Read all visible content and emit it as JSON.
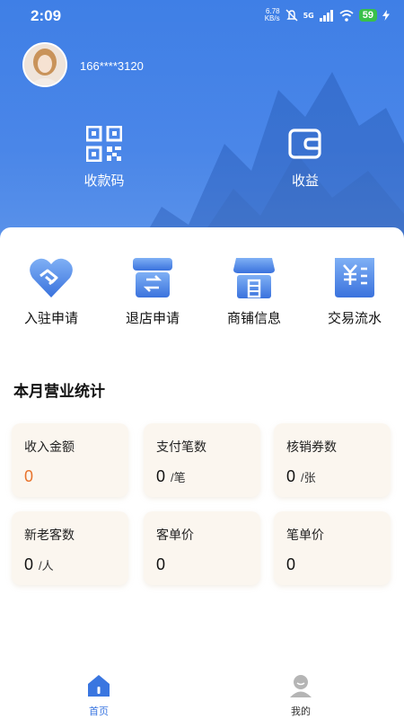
{
  "status_bar": {
    "time": "2:09",
    "net_speed_value": "6.78",
    "net_speed_unit": "KB/s",
    "network": "5G",
    "battery": "59"
  },
  "profile": {
    "phone": "166****3120"
  },
  "hero_actions": [
    {
      "label": "收款码",
      "icon": "qr-code-icon"
    },
    {
      "label": "收益",
      "icon": "wallet-icon"
    }
  ],
  "menu": [
    {
      "label": "入驻申请",
      "icon": "handshake-heart-icon"
    },
    {
      "label": "退店申请",
      "icon": "store-return-icon"
    },
    {
      "label": "商铺信息",
      "icon": "shop-icon"
    },
    {
      "label": "交易流水",
      "icon": "yen-ledger-icon"
    }
  ],
  "stats": {
    "title": "本月营业统计",
    "items": [
      {
        "label": "收入金额",
        "value": "0",
        "unit": ""
      },
      {
        "label": "支付笔数",
        "value": "0",
        "unit": "/笔"
      },
      {
        "label": "核销券数",
        "value": "0",
        "unit": "/张"
      },
      {
        "label": "新老客数",
        "value": "0",
        "unit": "/人"
      },
      {
        "label": "客单价",
        "value": "0",
        "unit": ""
      },
      {
        "label": "笔单价",
        "value": "0",
        "unit": ""
      }
    ]
  },
  "tabbar": [
    {
      "label": "首页",
      "icon": "home-icon",
      "active": true
    },
    {
      "label": "我的",
      "icon": "profile-icon",
      "active": false
    }
  ],
  "colors": {
    "header_blue": "#4a86e8",
    "accent_blue": "#3a76e0",
    "income_orange": "#e8732c",
    "stat_card_bg": "#fbf6ef"
  }
}
